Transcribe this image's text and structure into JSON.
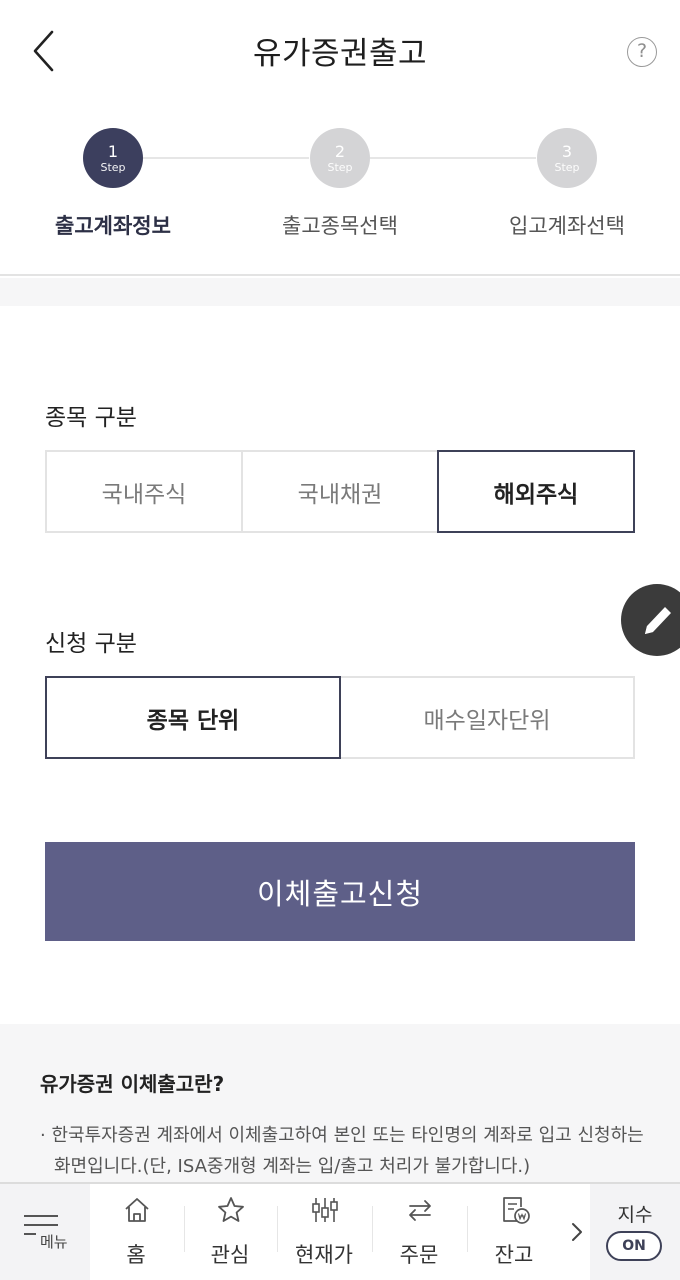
{
  "header": {
    "title": "유가증권출고",
    "help_glyph": "?"
  },
  "stepper": {
    "current_step": 1,
    "steps": [
      {
        "number": "1",
        "sub": "Step",
        "label": "출고계좌정보"
      },
      {
        "number": "2",
        "sub": "Step",
        "label": "출고종목선택"
      },
      {
        "number": "3",
        "sub": "Step",
        "label": "입고계좌선택"
      }
    ]
  },
  "item_type": {
    "label": "종목 구분",
    "options": [
      "국내주식",
      "국내채권",
      "해외주식"
    ],
    "selected": "해외주식"
  },
  "request_type": {
    "label": "신청 구분",
    "options": [
      "종목 단위",
      "매수일자단위"
    ],
    "selected": "종목 단위"
  },
  "submit_label": "이체출고신청",
  "info": {
    "title": "유가증권 이체출고란?",
    "text": "· 한국투자증권 계좌에서 이체출고하여 본인 또는 타인명의 계좌로 입고 신청하는 화면입니다.(단, ISA중개형 계좌는 입/출고 처리가 불가합니다.)"
  },
  "bottom_nav": {
    "menu_label": "메뉴",
    "items": [
      {
        "label": "홈",
        "icon": "home-icon"
      },
      {
        "label": "관심",
        "icon": "star-icon"
      },
      {
        "label": "현재가",
        "icon": "candlestick-icon"
      },
      {
        "label": "주문",
        "icon": "transfer-icon"
      },
      {
        "label": "잔고",
        "icon": "balance-icon"
      }
    ],
    "index_label": "지수",
    "index_toggle": "ON"
  },
  "colors": {
    "primary": "#5e5f88",
    "step_active": "#3c3f5e",
    "step_inactive": "#d4d4d6",
    "selected_border": "#3e4158"
  }
}
